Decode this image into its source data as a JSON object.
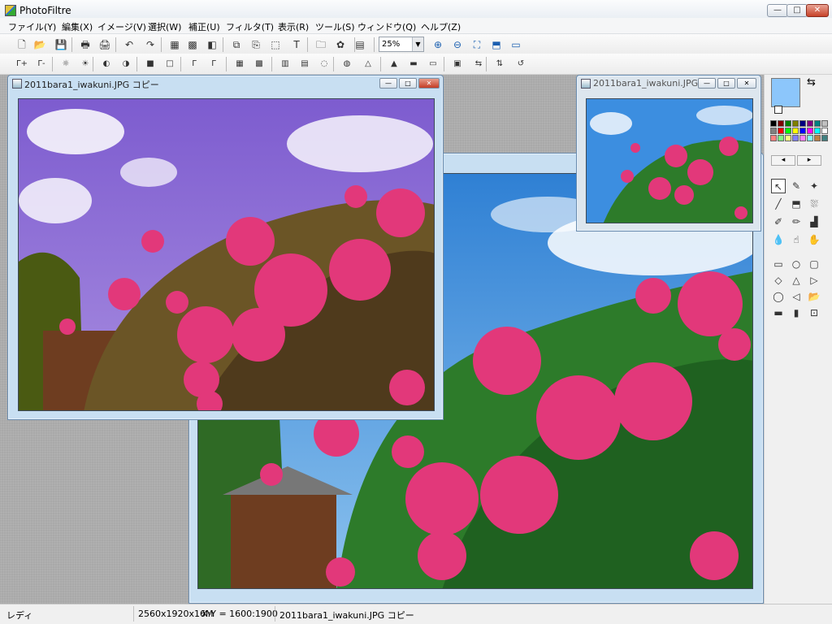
{
  "app": {
    "title": "PhotoFiltre",
    "colors": {
      "sky": "#3f8fd8",
      "rose": "#e23b7a",
      "leaf": "#2f7d2c",
      "purple_sky": "#8b6fd4"
    }
  },
  "window_controls": {
    "minimize": "—",
    "maximize": "□",
    "close": "✕"
  },
  "menu": {
    "items": [
      "ファイル(Y)",
      "編集(X)",
      "イメージ(V)",
      "選択(W)",
      "補正(U)",
      "フィルタ(T)",
      "表示(R)",
      "ツール(S)",
      "ウィンドウ(Q)",
      "ヘルプ(Z)"
    ]
  },
  "toolbar1": {
    "icons": [
      "new-document-icon",
      "open-folder-icon",
      "save-icon",
      "print-icon",
      "scan-icon",
      "undo-icon",
      "redo-icon",
      "grayscale-icon",
      "colors-icon",
      "auto-contrast-icon",
      "copy-layer-icon",
      "paste-layer-icon",
      "crop-icon",
      "text-icon",
      "browser-icon",
      "plugin-icon",
      "slideshow-icon"
    ],
    "glyphs": [
      "🗋",
      "📂",
      "💾",
      "🖶",
      "🖨",
      "↶",
      "↷",
      "▦",
      "▩",
      "◧",
      "⧉",
      "⎘",
      "⬚",
      "T",
      "🗀",
      "✿",
      "▤"
    ],
    "zoom": {
      "value": "25%",
      "dropdown_arrow": "▼"
    },
    "view_icons": [
      "zoom-in-icon",
      "zoom-out-icon",
      "fit-window-icon",
      "actual-size-icon",
      "fullscreen-icon"
    ],
    "view_glyphs": [
      "⊕",
      "⊖",
      "⛶",
      "⬒",
      "▭"
    ]
  },
  "toolbar2": {
    "icons": [
      "auto-level-icon",
      "auto-contrast-icon",
      "brightness-plus-icon",
      "brightness-minus-icon",
      "contrast-plus-icon",
      "contrast-minus-icon",
      "saturation-plus-icon",
      "saturation-minus-icon",
      "gamma-plus-icon",
      "gamma-minus-icon",
      "blur-icon",
      "sharpen-icon",
      "soften-icon",
      "light-blur-icon",
      "drop-icon",
      "drop2-icon",
      "triangle-icon",
      "triangle2-icon",
      "rainbow-icon",
      "monitor-icon",
      "texture-icon",
      "flip-h-icon",
      "flip-v-icon",
      "rotate-left-icon",
      "rotate-right-icon"
    ],
    "glyphs": [
      "Γ+",
      "Γ-",
      "☼",
      "☀",
      "◐",
      "◑",
      "■",
      "□",
      "Γ",
      "Γ",
      "▦",
      "▩",
      "▥",
      "▤",
      "◌",
      "◍",
      "△",
      "▲",
      "▬",
      "▭",
      "▣",
      "⇆",
      "⇅",
      "↺",
      "↻"
    ]
  },
  "documents": [
    {
      "title": "2011bara1_iwakuni.JPG コピー",
      "state": "active",
      "variant": "purple"
    },
    {
      "title": "2011bara1_iwakuni.JPG",
      "state": "inactive",
      "variant": "small"
    },
    {
      "title": "2011bara1_iwakuni.JPG",
      "state": "background",
      "variant": "main"
    }
  ],
  "palette": {
    "primary_color": "#8cc6fb",
    "secondary_color": "#ffffff",
    "swatches": [
      "#000000",
      "#7f0000",
      "#007f00",
      "#7f7f00",
      "#00007f",
      "#7f007f",
      "#007f7f",
      "#c0c0c0",
      "#808080",
      "#ff0000",
      "#00ff00",
      "#ffff00",
      "#0000ff",
      "#ff00ff",
      "#00ffff",
      "#ffffff",
      "#ff8080",
      "#80ff80",
      "#ffff80",
      "#8080ff",
      "#ff80ff",
      "#80ffff",
      "#c08040",
      "#408080"
    ],
    "swap_glyph": "⇆",
    "nav": {
      "prev": "◂",
      "next": "▸"
    },
    "tools": {
      "names": [
        "selection-arrow-icon",
        "color-picker-icon",
        "magic-wand-icon",
        "line-icon",
        "fill-bucket-icon",
        "spray-icon",
        "brush-icon",
        "pencil-icon",
        "stamp-icon",
        "blur-drop-icon",
        "smudge-icon",
        "hand-icon"
      ],
      "glyphs": [
        "↖",
        "✎",
        "✦",
        "╱",
        "⬒",
        "⛆",
        "✐",
        "✏",
        "▟",
        "💧",
        "☝",
        "✋"
      ]
    },
    "shapes": {
      "names": [
        "rectangle-shape-icon",
        "ellipse-shape-icon",
        "rounded-rect-shape-icon",
        "diamond-shape-icon",
        "triangle-shape-icon",
        "right-triangle-shape-icon",
        "lasso-icon",
        "polygon-lasso-icon",
        "open-selection-icon",
        "opt1-icon",
        "opt2-icon",
        "opt3-icon"
      ],
      "glyphs": [
        "▭",
        "○",
        "▢",
        "◇",
        "△",
        "▷",
        "◯",
        "◁",
        "📂",
        "▬",
        "▮",
        "⊡"
      ]
    }
  },
  "status": {
    "ready": "レディ",
    "dimensions": "2560x1920x16M",
    "coords": "X:Y = 1600:1900",
    "filename": "2011bara1_iwakuni.JPG コピー"
  }
}
